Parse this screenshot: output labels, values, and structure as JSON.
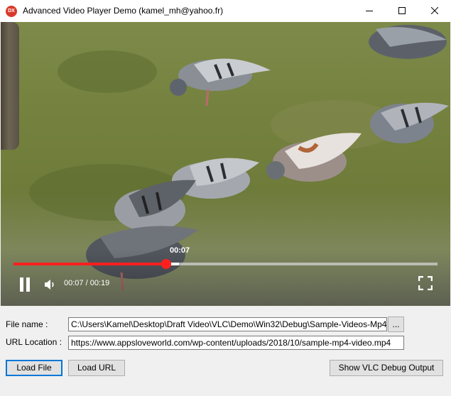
{
  "window": {
    "title": "Advanced Video Player Demo (kamel_mh@yahoo.fr)",
    "app_icon_text": "DX",
    "controls": [
      "minimize-icon",
      "maximize-icon",
      "close-icon"
    ]
  },
  "player": {
    "current_time_bubble": "00:07",
    "time_display": "00:07 / 00:19",
    "progress_fraction": 0.36,
    "buffered_fraction": 0.39,
    "accent_color": "#ff1f1f",
    "icons": [
      "pause-icon",
      "volume-icon",
      "fullscreen-icon"
    ]
  },
  "form": {
    "file_name_label": "File name :",
    "file_name_value": "C:\\Users\\Kamel\\Desktop\\Draft Video\\VLC\\Demo\\Win32\\Debug\\Sample-Videos-Mp4",
    "browse_label": "...",
    "url_label": "URL Location :",
    "url_value": "https://www.appsloveworld.com/wp-content/uploads/2018/10/sample-mp4-video.mp4"
  },
  "buttons": {
    "load_file": "Load File",
    "load_url": "Load URL",
    "show_debug": "Show VLC Debug Output"
  }
}
